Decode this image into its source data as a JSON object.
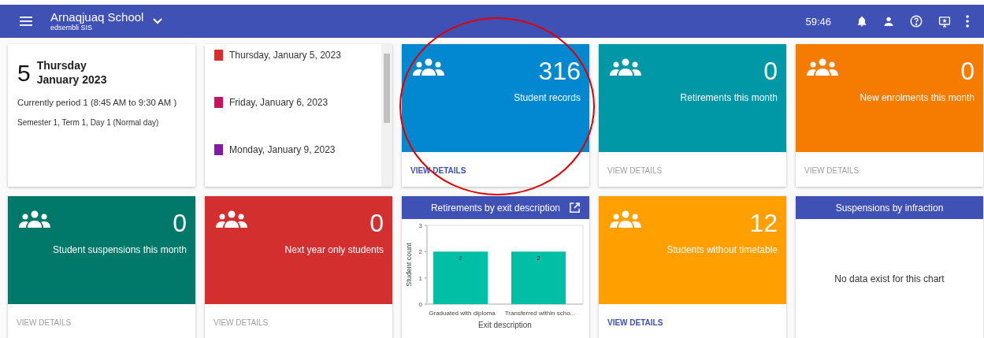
{
  "top_bar": {
    "school": "Arnaqjuaq School",
    "product": "edsembli SIS",
    "timer": "59:46"
  },
  "today": {
    "day": "5",
    "weekday": "Thursday",
    "month_year": "January 2023",
    "period": "Currently period 1 (8:45 AM to 9:30 AM )",
    "term": "Semester 1, Term 1, Day 1 (Normal day)"
  },
  "calendar": [
    {
      "date": "Thursday, January 5, 2023",
      "color": "#d32f2f"
    },
    {
      "date": "Friday, January 6, 2023",
      "color": "#c2185b"
    },
    {
      "date": "Monday, January 9, 2023",
      "color": "#7b1fa2"
    }
  ],
  "row_1": [
    {
      "kind": "stat",
      "value": "316",
      "label": "Student records",
      "color": "#0288d1",
      "link": "VIEW DETAILS",
      "disabled": false
    },
    {
      "kind": "stat",
      "value": "0",
      "label": "Retirements this month",
      "color": "#0097a7",
      "link": "VIEW DETAILS",
      "disabled": true
    },
    {
      "kind": "stat",
      "value": "0",
      "label": "New enrolments this month",
      "color": "#f57c00",
      "link": "VIEW DETAILS",
      "disabled": true
    }
  ],
  "row_2": [
    {
      "kind": "stat",
      "value": "0",
      "label": "Student suspensions this month",
      "color": "#00796b",
      "link": "VIEW DETAILS",
      "disabled": true
    },
    {
      "kind": "stat",
      "value": "0",
      "label": "Next year only students",
      "color": "#d32f2f",
      "link": "VIEW DETAILS",
      "disabled": true
    },
    {
      "kind": "chart",
      "title": "Retirements by exit description",
      "chart_data": {
        "type": "bar",
        "xlabel": "Exit description",
        "ylabel": "Student count",
        "categories": [
          "Graduated with diploma",
          "Transferred within scho..."
        ],
        "series": [
          {
            "color": "#00bfa5",
            "values": [
              2,
              2
            ]
          }
        ],
        "ylim": [
          0,
          3
        ],
        "yticks": [
          0,
          1,
          2,
          3
        ],
        "data_labels": true
      }
    },
    {
      "kind": "stat",
      "value": "12",
      "label": "Students without timetable",
      "color": "#ffa000",
      "link": "VIEW DETAILS",
      "disabled": false
    },
    {
      "kind": "empty_chart",
      "title": "Suspensions by infraction",
      "message": "No data exist for this chart"
    }
  ],
  "annotations": [
    {
      "kind": "circle"
    }
  ]
}
